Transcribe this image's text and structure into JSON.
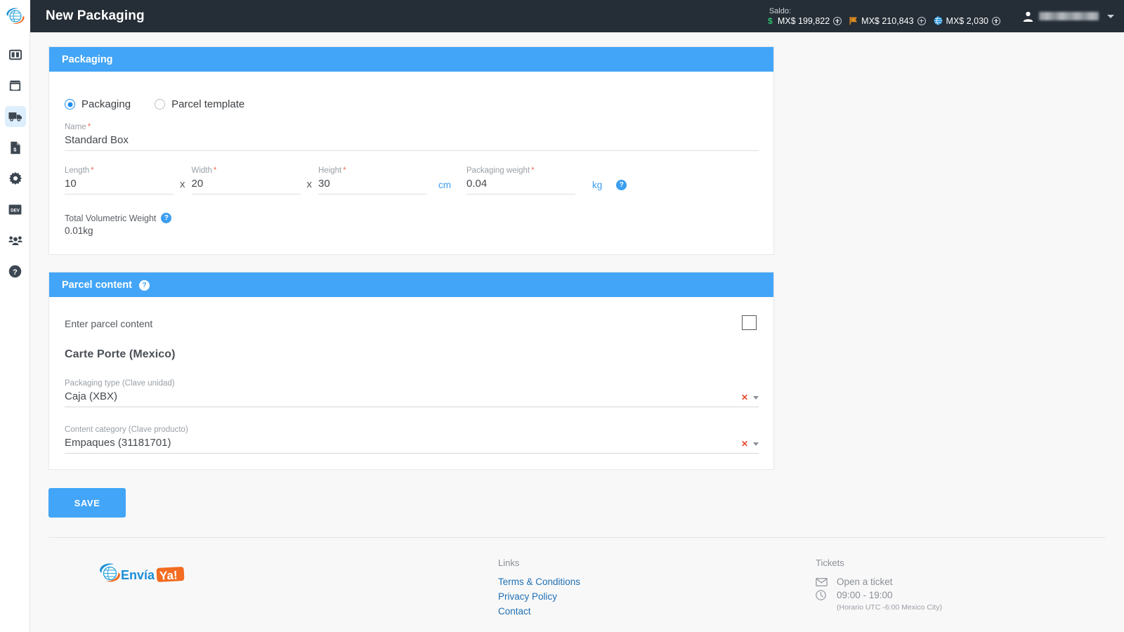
{
  "topbar": {
    "title": "New Packaging",
    "logo_alt": "enviaya-globe-logo",
    "balance_label": "Saldo:",
    "balances": [
      {
        "symbol": "$",
        "symbol_type": "dollar-sign",
        "amount": "MX$ 199,822",
        "add_action": "add-funds"
      },
      {
        "symbol": "⚑",
        "symbol_type": "flag",
        "amount": "MX$ 210,843",
        "add_action": "add-funds"
      },
      {
        "symbol": "🌐",
        "symbol_type": "globe",
        "amount": "MX$ 2,030",
        "add_action": "add-funds"
      }
    ],
    "user_name": "",
    "user_menu_icon": "chevron-down-icon"
  },
  "sidebar": {
    "items": [
      {
        "icon": "dashboard-columns-icon",
        "name": "dashboard",
        "active": false
      },
      {
        "icon": "store-icon",
        "name": "store",
        "active": false
      },
      {
        "icon": "truck-icon",
        "name": "shipments",
        "active": true
      },
      {
        "icon": "invoice-dollar-icon",
        "name": "billing",
        "active": false
      },
      {
        "icon": "gear-icon",
        "name": "settings",
        "active": false
      },
      {
        "icon": "dev-badge-icon",
        "name": "developers",
        "active": false
      },
      {
        "icon": "users-icon",
        "name": "users",
        "active": false
      },
      {
        "icon": "help-circle-icon",
        "name": "help",
        "active": false
      }
    ]
  },
  "packaging_card": {
    "header": "Packaging",
    "mode_options": [
      {
        "label": "Packaging",
        "selected": true
      },
      {
        "label": "Parcel template",
        "selected": false
      }
    ],
    "name": {
      "label": "Name",
      "required": true,
      "value": "Standard Box"
    },
    "length": {
      "label": "Length",
      "required": true,
      "value": "10"
    },
    "width": {
      "label": "Width",
      "required": true,
      "value": "20"
    },
    "height": {
      "label": "Height",
      "required": true,
      "value": "30"
    },
    "multiply_symbol": "x",
    "dimension_unit": "cm",
    "packaging_weight": {
      "label": "Packaging weight",
      "required": true,
      "value": "0.04"
    },
    "weight_unit": "kg",
    "weight_help_icon": "help-circle-icon",
    "volumetric": {
      "label": "Total Volumetric Weight",
      "help_icon": "help-circle-icon",
      "value": "0.01kg"
    }
  },
  "parcel_card": {
    "header": "Parcel content",
    "header_help_icon": "help-circle-icon",
    "enter_parcel_content_label": "Enter parcel content",
    "enter_parcel_content_checked": false,
    "carte_porte_title": "Carte Porte (Mexico)",
    "packaging_type": {
      "label": "Packaging type (Clave unidad)",
      "value": "Caja (XBX)",
      "clear_icon": "close-x-icon",
      "caret_icon": "chevron-down-icon"
    },
    "content_category": {
      "label": "Content category (Clave producto)",
      "value": "Empaques (31181701)",
      "clear_icon": "close-x-icon",
      "caret_icon": "chevron-down-icon"
    }
  },
  "actions": {
    "save_label": "SAVE"
  },
  "footer": {
    "logo_text_primary": "Envía",
    "logo_text_badge": "Ya!",
    "links_title": "Links",
    "links": [
      {
        "label": "Terms & Conditions"
      },
      {
        "label": "Privacy Policy"
      },
      {
        "label": "Contact"
      }
    ],
    "tickets_title": "Tickets",
    "open_ticket_label": "Open a ticket",
    "open_ticket_icon": "envelope-icon",
    "hours_label": "09:00 - 19:00",
    "hours_icon": "clock-icon",
    "hours_note": "(Horario UTC -6:00 Mexico City)"
  },
  "colors": {
    "topbar_bg": "#252d36",
    "card_header_blue": "#42a5f7",
    "accent_blue": "#3b9ef0",
    "link_blue": "#1f6fb2",
    "required_red": "#ef6e5c",
    "clear_red": "#e8492f",
    "sidebar_active_bg": "#ddeefc"
  }
}
